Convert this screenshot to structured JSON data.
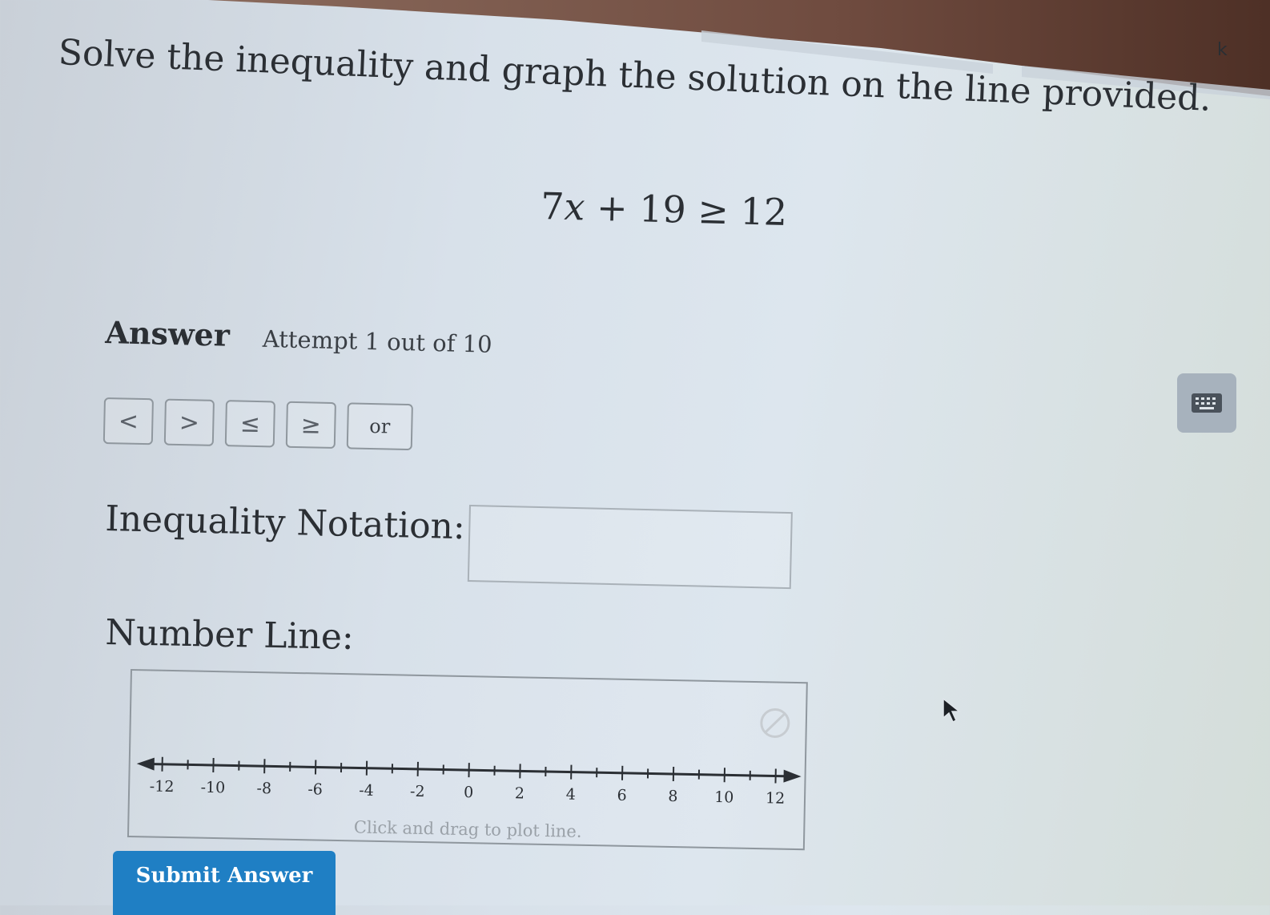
{
  "corner_glyph": "k",
  "question": {
    "text": "Solve the inequality and graph the solution on the line provided.",
    "equation": {
      "coef": "7",
      "variable": "x",
      "rest": " + 19 ≥ 12"
    }
  },
  "answer": {
    "label": "Answer",
    "attempt": "Attempt 1 out of 10"
  },
  "symbol_buttons": [
    "<",
    ">",
    "≤",
    "≥",
    "or"
  ],
  "keyboard_icon": "keyboard-icon",
  "inequality_notation": {
    "label": "Inequality Notation:",
    "value": "",
    "placeholder": ""
  },
  "number_line": {
    "label": "Number Line:",
    "ticks": [
      "-12",
      "-10",
      "-8",
      "-6",
      "-4",
      "-2",
      "0",
      "2",
      "4",
      "6",
      "8",
      "10",
      "12"
    ],
    "min": -13,
    "max": 13,
    "hint": "Click and drag to plot line."
  },
  "submit": {
    "label": "Submit Answer"
  },
  "colors": {
    "accent": "#1f7fc4",
    "text": "#2b2f34"
  }
}
